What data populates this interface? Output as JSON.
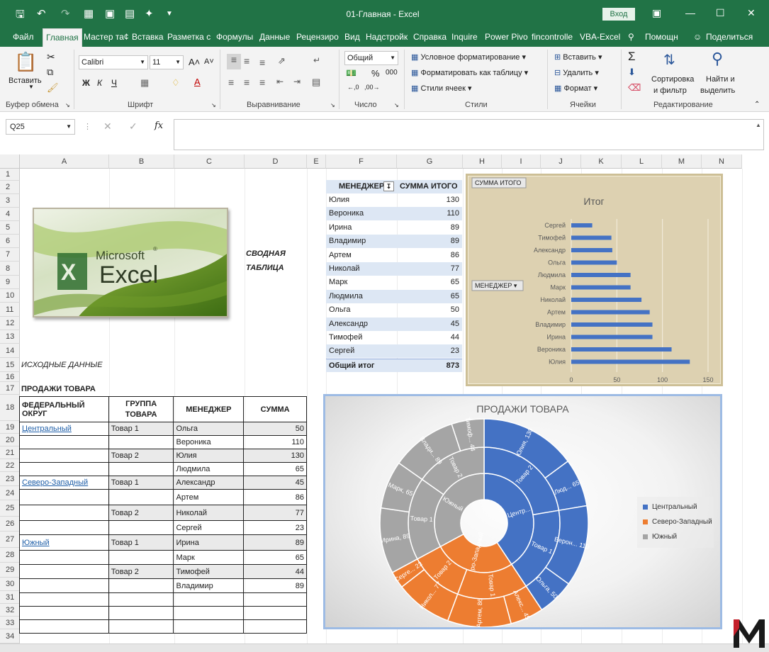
{
  "titlebar": {
    "title": "01-Главная  -  Excel",
    "login": "Вход"
  },
  "tabs": [
    "Файл",
    "Главная",
    "Мастер та¢",
    "Вставка",
    "Разметка с",
    "Формулы",
    "Данные",
    "Рецензиро",
    "Вид",
    "Надстройк",
    "Справка",
    "Inquire",
    "Power Pivo",
    "fincontrolle",
    "VBA-Excel",
    "Помощн",
    "Поделиться"
  ],
  "ribbon": {
    "paste": "Вставить",
    "font_name": "Calibri",
    "font_size": "11",
    "bold": "Ж",
    "italic": "К",
    "underline": "Ч",
    "number_format": "Общий",
    "cond_format": "Условное форматирование",
    "format_table": "Форматировать как таблицу",
    "cell_styles": "Стили ячеек",
    "insert": "Вставить",
    "delete": "Удалить",
    "format": "Формат",
    "sort_filter_1": "Сортировка",
    "sort_filter_2": "и фильтр",
    "find_1": "Найти и",
    "find_2": "выделить",
    "groups": [
      "Буфер обмена",
      "Шрифт",
      "Выравнивание",
      "Число",
      "Стили",
      "Ячейки",
      "Редактирование"
    ]
  },
  "formula": {
    "namebox": "Q25",
    "fx": "fx"
  },
  "columns": [
    "A",
    "B",
    "C",
    "D",
    "E",
    "F",
    "G",
    "H",
    "I",
    "J",
    "K",
    "L",
    "M",
    "N"
  ],
  "rows": [
    "1",
    "2",
    "3",
    "4",
    "5",
    "6",
    "7",
    "8",
    "9",
    "10",
    "11",
    "12",
    "13",
    "14",
    "15",
    "16",
    "17",
    "18",
    "19",
    "20",
    "21",
    "22",
    "23",
    "24",
    "25",
    "26",
    "27",
    "28",
    "29",
    "30",
    "31",
    "32",
    "33",
    "34"
  ],
  "logo": {
    "brand": "Microsoft",
    "product": "Excel",
    "sup": "®"
  },
  "labels": {
    "pivot_caption_1": "СВОДНАЯ",
    "pivot_caption_2": "ТАБЛИЦА",
    "source": "ИСХОДНЫЕ ДАННЫЕ",
    "sales": "ПРОДАЖИ ТОВАРА"
  },
  "pivot": {
    "header_manager": "МЕНЕДЖЕР",
    "header_sum": "СУММА ИТОГО",
    "rows": [
      {
        "name": "Юлия",
        "value": "130"
      },
      {
        "name": "Вероника",
        "value": "110"
      },
      {
        "name": "Ирина",
        "value": "89"
      },
      {
        "name": "Владимир",
        "value": "89"
      },
      {
        "name": "Артем",
        "value": "86"
      },
      {
        "name": "Николай",
        "value": "77"
      },
      {
        "name": "Марк",
        "value": "65"
      },
      {
        "name": "Людмила",
        "value": "65"
      },
      {
        "name": "Ольга",
        "value": "50"
      },
      {
        "name": "Александр",
        "value": "45"
      },
      {
        "name": "Тимофей",
        "value": "44"
      },
      {
        "name": "Сергей",
        "value": "23"
      }
    ],
    "total_label": "Общий итог",
    "total_value": "873"
  },
  "table": {
    "headers": [
      "ФЕДЕРАЛЬНЫЙ ОКРУГ",
      "ГРУППА ТОВАРА",
      "МЕНЕДЖЕР",
      "СУММА"
    ],
    "rows": [
      [
        "Центральный",
        "Товар 1",
        "Ольга",
        "50"
      ],
      [
        "",
        "",
        "Вероника",
        "110"
      ],
      [
        "",
        "Товар 2",
        "Юлия",
        "130"
      ],
      [
        "",
        "",
        "Людмила",
        "65"
      ],
      [
        "Северо-Западный",
        "Товар 1",
        "Александр",
        "45"
      ],
      [
        "",
        "",
        "Артем",
        "86"
      ],
      [
        "",
        "Товар 2",
        "Николай",
        "77"
      ],
      [
        "",
        "",
        "Сергей",
        "23"
      ],
      [
        "Южный",
        "Товар 1",
        "Ирина",
        "89"
      ],
      [
        "",
        "",
        "Марк",
        "65"
      ],
      [
        "",
        "Товар 2",
        "Тимофей",
        "44"
      ],
      [
        "",
        "",
        "Владимир",
        "89"
      ],
      [
        "",
        "",
        "",
        ""
      ],
      [
        "",
        "",
        "",
        ""
      ],
      [
        "",
        "",
        "",
        ""
      ]
    ]
  },
  "chart_data": [
    {
      "type": "bar",
      "title": "Итог",
      "field_button": "СУММА ИТОГО",
      "axis_button": "МЕНЕДЖЕР",
      "categories": [
        "Сергей",
        "Тимофей",
        "Александр",
        "Ольга",
        "Людмила",
        "Марк",
        "Николай",
        "Артем",
        "Владимир",
        "Ирина",
        "Вероника",
        "Юлия"
      ],
      "values": [
        23,
        44,
        45,
        50,
        65,
        65,
        77,
        86,
        89,
        89,
        110,
        130
      ],
      "xlim": [
        0,
        150
      ],
      "xticks": [
        "0",
        "50",
        "100",
        "150"
      ],
      "grid": true,
      "color": "#4472c4",
      "orientation": "horizontal"
    },
    {
      "type": "sunburst",
      "title": "ПРОДАЖИ ТОВАРА",
      "legend": [
        "Центральный",
        "Северо-Западный",
        "Южный"
      ],
      "legend_position": "right",
      "colors": [
        "#4472c4",
        "#ed7d31",
        "#a5a5a5"
      ],
      "rings": {
        "inner": [
          {
            "label": "Центр...",
            "value": 355,
            "group": 0
          },
          {
            "label": "Северо-Западный",
            "value": 231,
            "group": 1
          },
          {
            "label": "Южный",
            "value": 287,
            "group": 2
          }
        ],
        "middle": [
          {
            "label": "Товар 2",
            "value": 195,
            "group": 0
          },
          {
            "label": "Товар 1",
            "value": 160,
            "group": 0
          },
          {
            "label": "Товар 1",
            "value": 131,
            "group": 1
          },
          {
            "label": "Товар 2",
            "value": 100,
            "group": 1
          },
          {
            "label": "Товар 1",
            "value": 154,
            "group": 2
          },
          {
            "label": "Товар 2",
            "value": 133,
            "group": 2
          }
        ],
        "outer": [
          {
            "label": "Юлия, 130",
            "value": 130,
            "group": 0
          },
          {
            "label": "Люд... 65",
            "value": 65,
            "group": 0
          },
          {
            "label": "Верон... 110",
            "value": 110,
            "group": 0
          },
          {
            "label": "Ольга, 50",
            "value": 50,
            "group": 0
          },
          {
            "label": "Алекс... 45",
            "value": 45,
            "group": 1
          },
          {
            "label": "Артем, 86",
            "value": 86,
            "group": 1
          },
          {
            "label": "Никол... 77",
            "value": 77,
            "group": 1
          },
          {
            "label": "Серге... 23",
            "value": 23,
            "group": 1
          },
          {
            "label": "Ирина, 89",
            "value": 89,
            "group": 2
          },
          {
            "label": "Марк, 65",
            "value": 65,
            "group": 2
          },
          {
            "label": "Влади... 89",
            "value": 89,
            "group": 2
          },
          {
            "label": "Тимоф... 44",
            "value": 44,
            "group": 2
          }
        ]
      }
    }
  ],
  "watermark": "M"
}
